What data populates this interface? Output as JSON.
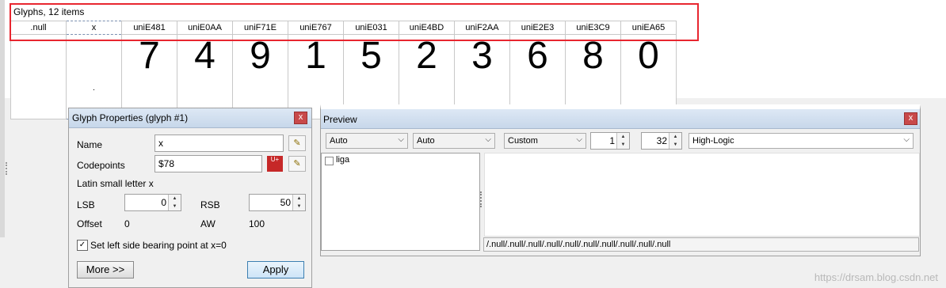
{
  "grid": {
    "title": "Glyphs, 12 items",
    "headers": [
      ".null",
      "x",
      "uniE481",
      "uniE0AA",
      "uniF71E",
      "uniE767",
      "uniE031",
      "uniE4BD",
      "uniF2AA",
      "uniE2E3",
      "uniE3C9",
      "uniEA65"
    ],
    "glyphs": [
      "",
      ".",
      "7",
      "4",
      "9",
      "1",
      "5",
      "2",
      "3",
      "6",
      "8",
      "0"
    ],
    "selected_index": 1,
    "highlight_color": "#e8262f"
  },
  "props": {
    "title": "Glyph Properties (glyph #1)",
    "close": "x",
    "name_label": "Name",
    "name_value": "x",
    "codepoints_label": "Codepoints",
    "codepoints_value": "$78",
    "unicode_logo": "U+",
    "description": "Latin small letter x",
    "lsb_label": "LSB",
    "lsb_value": "0",
    "rsb_label": "RSB",
    "rsb_value": "50",
    "offset_label": "Offset",
    "offset_value": "0",
    "aw_label": "AW",
    "aw_value": "100",
    "checkbox_label": "Set left side bearing point at x=0",
    "checkbox_checked": "✓",
    "more_button": "More >>",
    "apply_button": "Apply"
  },
  "preview": {
    "title": "Preview",
    "close": "x",
    "combo1": "Auto",
    "combo2": "Auto",
    "combo3": "Custom",
    "spin1": "1",
    "spin2": "32",
    "renderer": "High-Logic",
    "feature": "liga",
    "status_text": "/.null/.null/.null/.null/.null/.null/.null/.null/.null/.null"
  },
  "watermark": "https://drsam.blog.csdn.net"
}
